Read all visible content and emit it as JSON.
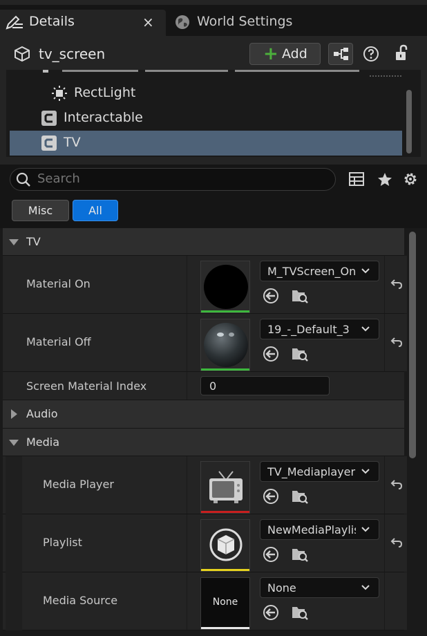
{
  "tabs": {
    "details": "Details",
    "close": "×",
    "world_settings": "World Settings"
  },
  "header": {
    "actor_name": "tv_screen",
    "add_label": "Add"
  },
  "tree": {
    "items": [
      {
        "label": "RectLight"
      },
      {
        "label": "Interactable"
      },
      {
        "label": "TV"
      }
    ]
  },
  "search": {
    "placeholder": "Search"
  },
  "filters": {
    "misc": "Misc",
    "all": "All"
  },
  "properties": {
    "cat_tv": "TV",
    "material_on": {
      "label": "Material On",
      "value": "M_TVScreen_On"
    },
    "material_off": {
      "label": "Material Off",
      "value": "19_-_Default_3"
    },
    "screen_index": {
      "label": "Screen Material Index",
      "value": "0"
    },
    "cat_audio": "Audio",
    "cat_media": "Media",
    "media_player": {
      "label": "Media Player",
      "value": "TV_Mediaplayer"
    },
    "playlist": {
      "label": "Playlist",
      "value": "NewMediaPlaylis"
    },
    "media_source": {
      "label": "Media Source",
      "value": "None",
      "thumb_text": "None"
    }
  },
  "colors": {
    "accent_blue": "#0a70d9",
    "selection": "#4e6278",
    "add_green": "#4caf3c",
    "bar_green": "#3db83d",
    "bar_red": "#c81e1e",
    "bar_yellow": "#e6d21e",
    "bar_white": "#e8e8e8"
  }
}
